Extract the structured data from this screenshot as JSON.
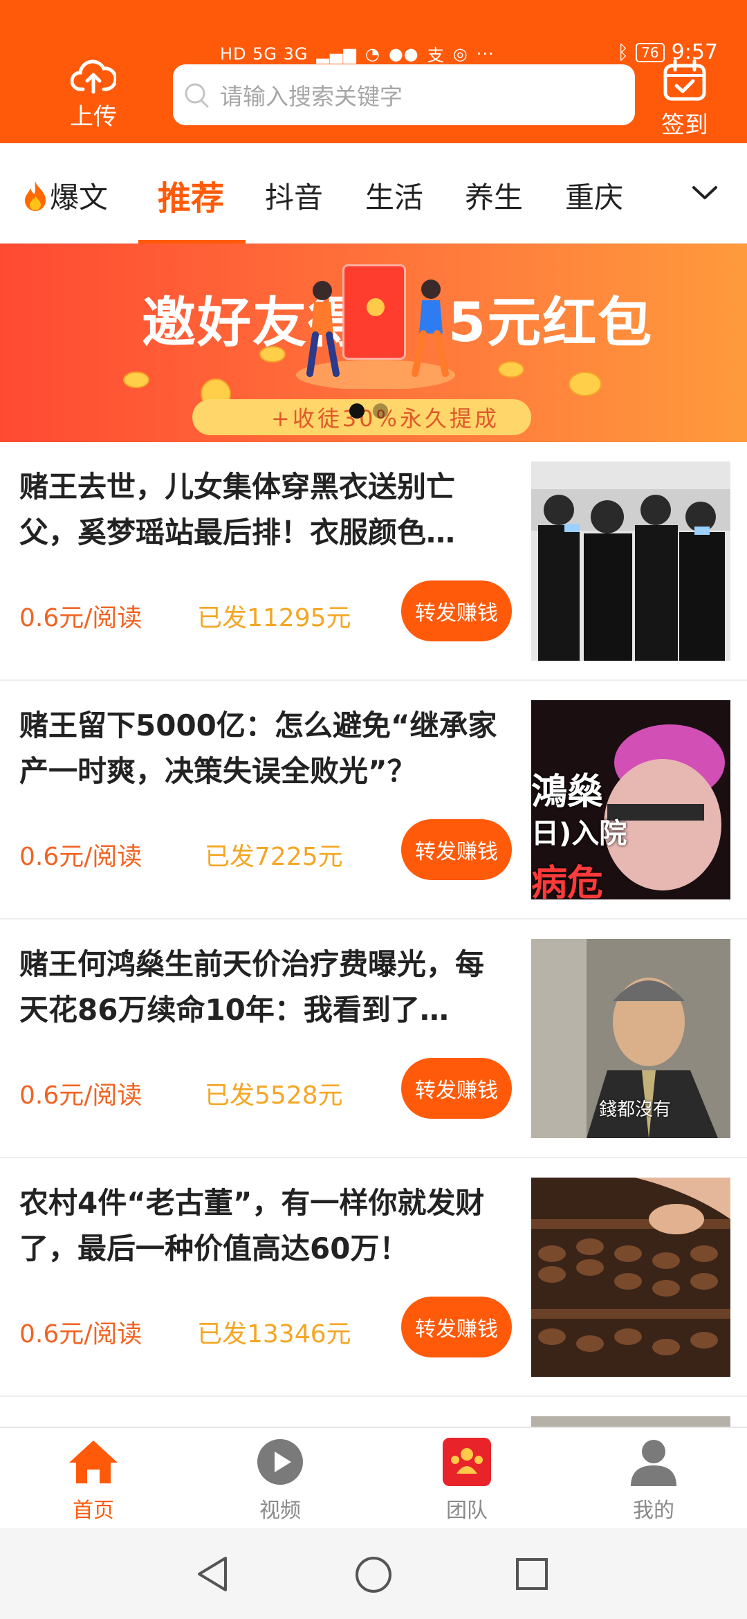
{
  "statusbar": {
    "network": "HD 5G 3G",
    "battery": "76",
    "time": "9:57"
  },
  "header": {
    "upload_label": "上传",
    "search_placeholder": "请输入搜索关键字",
    "checkin_label": "签到",
    "accent_color": "#ff5a0a"
  },
  "tabs": [
    {
      "label": "爆文"
    },
    {
      "label": "推荐"
    },
    {
      "label": "抖音"
    },
    {
      "label": "生活"
    },
    {
      "label": "养生"
    },
    {
      "label": "重庆"
    }
  ],
  "banner": {
    "left_text": "邀好友得",
    "right_text": "5元红包",
    "sub_text": "+收徒30%永久提成"
  },
  "articles": [
    {
      "title": "赌王去世，儿女集体穿黑衣送别亡父，奚梦瑶站最后排！衣服颜色…",
      "rate": "0.6元/阅读",
      "sent": "已发11295元",
      "share_label": "转发赚钱"
    },
    {
      "title": "赌王留下5000亿：怎么避免“继承家产一时爽，决策失误全败光”？",
      "rate": "0.6元/阅读",
      "sent": "已发7225元",
      "share_label": "转发赚钱",
      "thumb_text_1": "鴻燊",
      "thumb_text_2": "日)入院",
      "thumb_text_3": "病危"
    },
    {
      "title": "赌王何鸿燊生前天价治疗费曝光，每天花86万续命10年：我看到了…",
      "rate": "0.6元/阅读",
      "sent": "已发5528元",
      "share_label": "转发赚钱",
      "thumb_caption": "錢都沒有"
    },
    {
      "title": "农村4件“老古董”，有一样你就发财了，最后一种价值高达60万！",
      "rate": "0.6元/阅读",
      "sent": "已发13346元",
      "share_label": "转发赚钱"
    }
  ],
  "bottom_nav": [
    {
      "label": "首页"
    },
    {
      "label": "视频"
    },
    {
      "label": "团队"
    },
    {
      "label": "我的"
    }
  ]
}
